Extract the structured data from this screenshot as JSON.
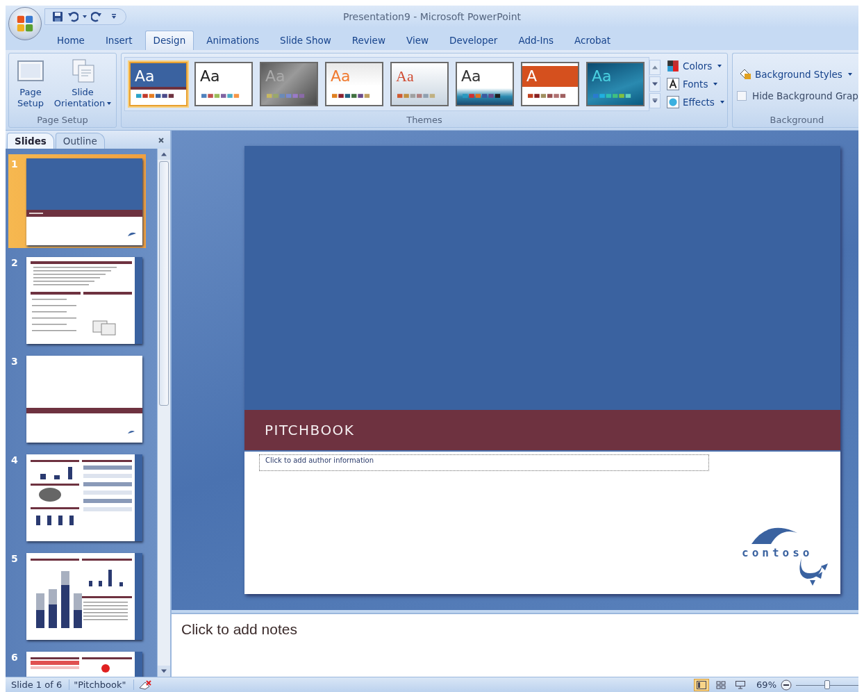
{
  "window": {
    "title": "Presentation9 - Microsoft PowerPoint"
  },
  "ribbon_tabs": [
    {
      "label": "Home",
      "selected": false
    },
    {
      "label": "Insert",
      "selected": false
    },
    {
      "label": "Design",
      "selected": true
    },
    {
      "label": "Animations",
      "selected": false
    },
    {
      "label": "Slide Show",
      "selected": false
    },
    {
      "label": "Review",
      "selected": false
    },
    {
      "label": "View",
      "selected": false
    },
    {
      "label": "Developer",
      "selected": false
    },
    {
      "label": "Add-Ins",
      "selected": false
    },
    {
      "label": "Acrobat",
      "selected": false
    }
  ],
  "page_setup": {
    "label": "Page Setup",
    "buttons": [
      {
        "kind": "page",
        "label": "Page Setup"
      },
      {
        "kind": "orientation",
        "label": "Slide Orientation"
      }
    ]
  },
  "themes": {
    "label": "Themes",
    "items": [
      {
        "kind": "office-blue",
        "sample": "Aa",
        "selected": true
      },
      {
        "kind": "plain",
        "sample": "Aa",
        "selected": false
      },
      {
        "kind": "dark-gray",
        "sample": "Aa",
        "selected": false
      },
      {
        "kind": "orange",
        "sample": "Aa",
        "selected": false
      },
      {
        "kind": "serif-red",
        "sample": "Aa",
        "selected": false
      },
      {
        "kind": "white-teal",
        "sample": "Aa",
        "selected": false
      },
      {
        "kind": "orange-band",
        "sample": "A",
        "selected": false
      },
      {
        "kind": "teal",
        "sample": "Aa",
        "selected": false
      }
    ],
    "options": [
      {
        "kind": "colors",
        "label": "Colors"
      },
      {
        "kind": "fonts",
        "label": "Fonts"
      },
      {
        "kind": "effects",
        "label": "Effects"
      }
    ]
  },
  "background": {
    "label": "Background",
    "styles_button": "Background Styles",
    "hide_graphics": {
      "label": "Hide Background Grap",
      "checked": false
    }
  },
  "pane_tabs": [
    {
      "label": "Slides",
      "selected": true
    },
    {
      "label": "Outline",
      "selected": false
    }
  ],
  "slides": [
    {
      "number": "1",
      "kind": "title",
      "selected": true
    },
    {
      "number": "2",
      "kind": "text",
      "selected": false
    },
    {
      "number": "3",
      "kind": "section",
      "selected": false
    },
    {
      "number": "4",
      "kind": "charts",
      "selected": false
    },
    {
      "number": "5",
      "kind": "bars",
      "selected": false
    },
    {
      "number": "6",
      "kind": "table",
      "selected": false
    }
  ],
  "slide": {
    "title": "PITCHBOOK",
    "author_placeholder": "Click to add author information",
    "logo": "contoso"
  },
  "notes": {
    "placeholder": "Click to add notes"
  },
  "status_bar": {
    "slide": "Slide 1 of 6",
    "theme": "\"Pitchbook\"",
    "views": [
      {
        "kind": "normal",
        "selected": true
      },
      {
        "kind": "sorter",
        "selected": false
      },
      {
        "kind": "show",
        "selected": false
      }
    ],
    "zoom": "69%",
    "zoom_slider": {
      "level": 0.45
    }
  }
}
